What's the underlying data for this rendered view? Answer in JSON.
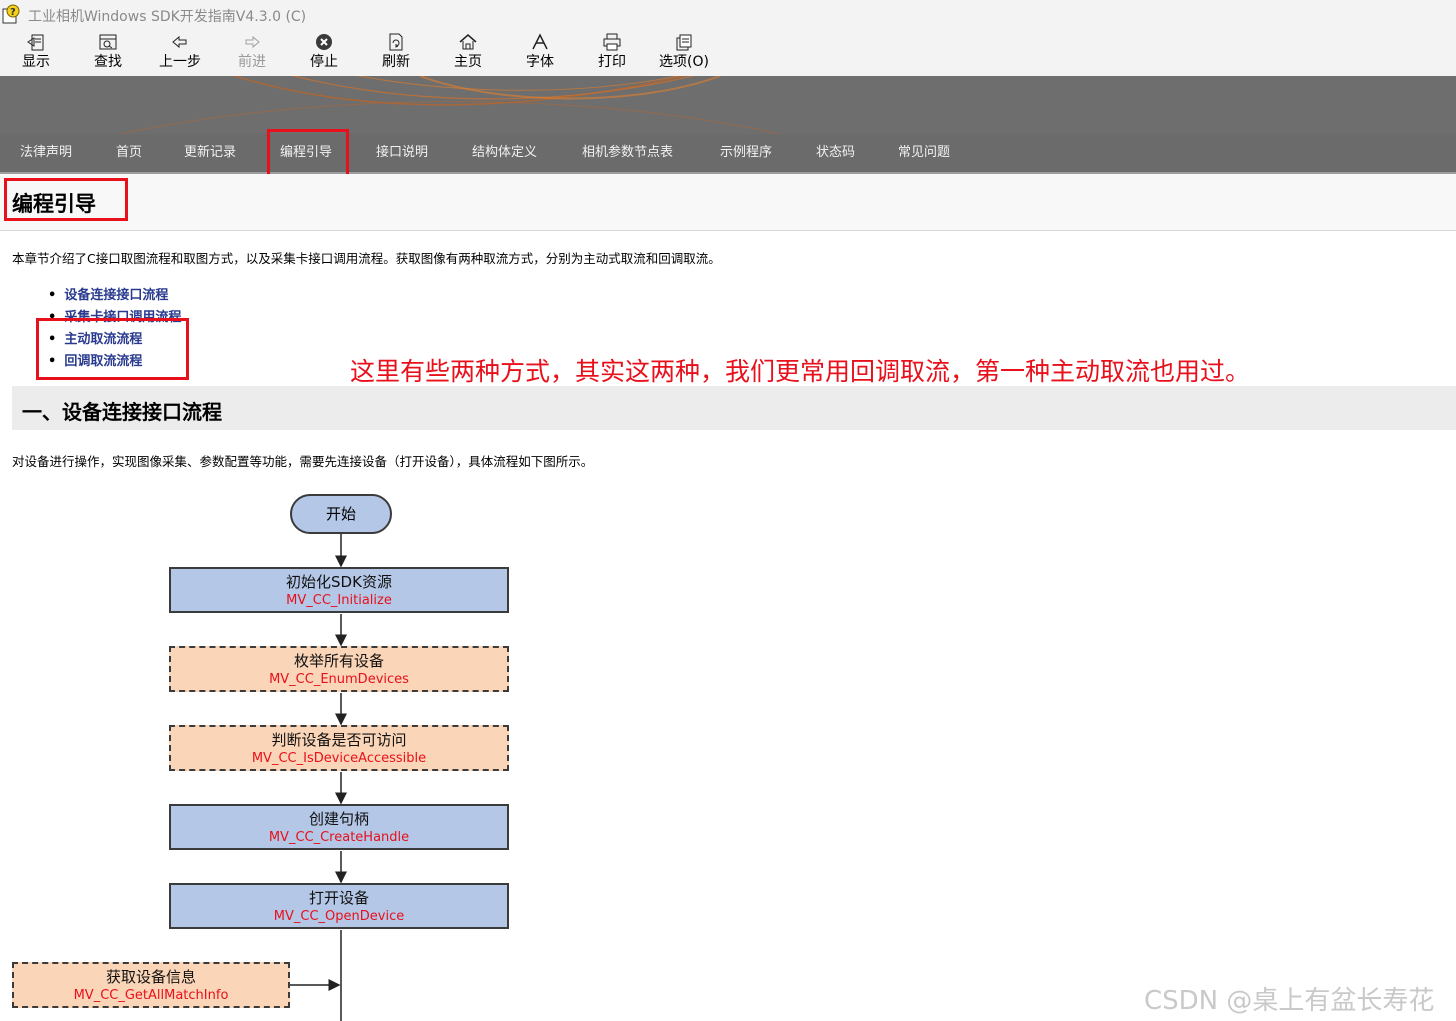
{
  "window": {
    "title": "工业相机Windows SDK开发指南V4.3.0  (C)"
  },
  "toolbar": {
    "buttons": [
      {
        "label": "显示",
        "icon": "show-icon"
      },
      {
        "label": "查找",
        "icon": "find-icon"
      },
      {
        "label": "上一步",
        "icon": "back-icon"
      },
      {
        "label": "前进",
        "icon": "forward-icon",
        "disabled": true
      },
      {
        "label": "停止",
        "icon": "stop-icon"
      },
      {
        "label": "刷新",
        "icon": "refresh-icon"
      },
      {
        "label": "主页",
        "icon": "home-icon"
      },
      {
        "label": "字体",
        "icon": "font-icon"
      },
      {
        "label": "打印",
        "icon": "print-icon"
      },
      {
        "label": "选项(O)",
        "icon": "options-icon"
      }
    ]
  },
  "nav": {
    "items": [
      "法律声明",
      "首页",
      "更新记录",
      "编程引导",
      "接口说明",
      "结构体定义",
      "相机参数节点表",
      "示例程序",
      "状态码",
      "常见问题"
    ],
    "active": "编程引导"
  },
  "page": {
    "title": "编程引导",
    "intro": "本章节介绍了C接口取图流程和取图方式，以及采集卡接口调用流程。获取图像有两种取流方式，分别为主动式取流和回调取流。",
    "toc": [
      "设备连接接口流程",
      "采集卡接口调用流程",
      "主动取流流程",
      "回调取流流程"
    ],
    "annotation": "这里有些两种方式，其实这两种，我们更常用回调取流，第一种主动取流也用过。",
    "section_title": "一、设备连接接口流程",
    "section_text": "对设备进行操作，实现图像采集、参数配置等功能，需要先连接设备（打开设备），具体流程如下图所示。"
  },
  "flowchart": {
    "start": "开始",
    "steps": [
      {
        "title": "初始化SDK资源",
        "api": "MV_CC_Initialize",
        "style": "required"
      },
      {
        "title": "枚举所有设备",
        "api": "MV_CC_EnumDevices",
        "style": "optional"
      },
      {
        "title": "判断设备是否可访问",
        "api": "MV_CC_IsDeviceAccessible",
        "style": "optional"
      },
      {
        "title": "创建句柄",
        "api": "MV_CC_CreateHandle",
        "style": "required"
      },
      {
        "title": "打开设备",
        "api": "MV_CC_OpenDevice",
        "style": "required"
      }
    ],
    "side_step": {
      "title": "获取设备信息",
      "api": "MV_CC_GetAllMatchInfo",
      "style": "optional"
    }
  },
  "watermark": "CSDN @桌上有盆长寿花",
  "colors": {
    "accent_red": "#e8101b",
    "link_blue": "#2a3b8f",
    "node_blue": "#b4c7e7",
    "node_orange": "#fbd5b8",
    "nav_bg": "#6b6b6b"
  }
}
